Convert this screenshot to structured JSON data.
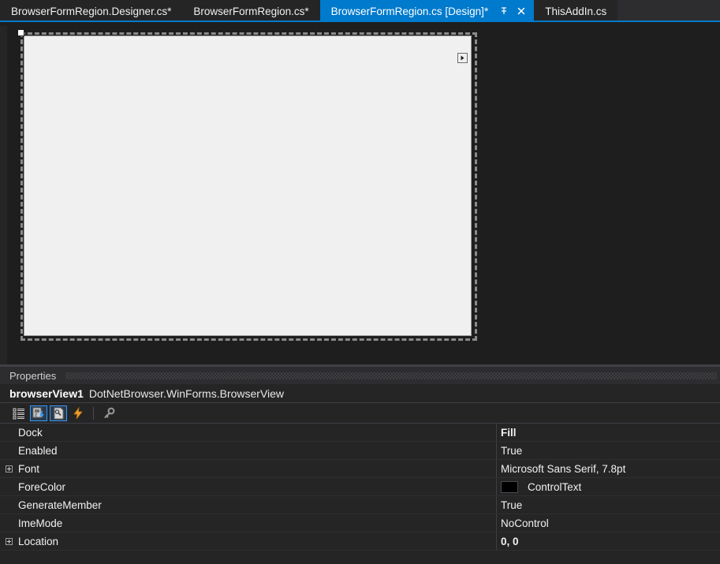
{
  "tabs": [
    {
      "label": "BrowserFormRegion.Designer.cs*",
      "active": false
    },
    {
      "label": "BrowserFormRegion.cs*",
      "active": false
    },
    {
      "label": "BrowserFormRegion.cs [Design]*",
      "active": true
    },
    {
      "label": "ThisAddIn.cs",
      "active": false
    }
  ],
  "tab_actions": {
    "pin_icon": "pin-icon",
    "close_icon": "close-icon",
    "close_label": "✕"
  },
  "designer": {
    "action_glyph_icon": "smart-tag-arrow-icon",
    "handle_icon": "resize-handle"
  },
  "properties": {
    "panel_title": "Properties",
    "object_name": "browserView1",
    "object_type": "DotNetBrowser.WinForms.BrowserView",
    "toolbar": [
      {
        "name": "categorized-button",
        "title": "Categorized",
        "checked": false
      },
      {
        "name": "alphabetical-button",
        "title": "Alphabetical",
        "checked": true
      },
      {
        "name": "properties-button",
        "title": "Properties",
        "checked": true
      },
      {
        "name": "events-button",
        "title": "Events",
        "checked": false
      },
      {
        "name": "property-pages-button",
        "title": "Property Pages",
        "checked": false
      }
    ],
    "rows": [
      {
        "name": "Dock",
        "value": "Fill",
        "bold": true,
        "expandable": false,
        "swatch": null
      },
      {
        "name": "Enabled",
        "value": "True",
        "bold": false,
        "expandable": false,
        "swatch": null
      },
      {
        "name": "Font",
        "value": "Microsoft Sans Serif, 7.8pt",
        "bold": false,
        "expandable": true,
        "swatch": null
      },
      {
        "name": "ForeColor",
        "value": "ControlText",
        "bold": false,
        "expandable": false,
        "swatch": "#000000"
      },
      {
        "name": "GenerateMember",
        "value": "True",
        "bold": false,
        "expandable": false,
        "swatch": null
      },
      {
        "name": "ImeMode",
        "value": "NoControl",
        "bold": false,
        "expandable": false,
        "swatch": null
      },
      {
        "name": "Location",
        "value": "0, 0",
        "bold": true,
        "expandable": true,
        "swatch": null
      }
    ]
  },
  "colors": {
    "accent": "#007acc",
    "window_bg": "#1e1e1e",
    "panel_bg": "#252526",
    "header_bg": "#2d2d30",
    "form_surface": "#f0f0f0",
    "divider": "#3f3f46"
  }
}
